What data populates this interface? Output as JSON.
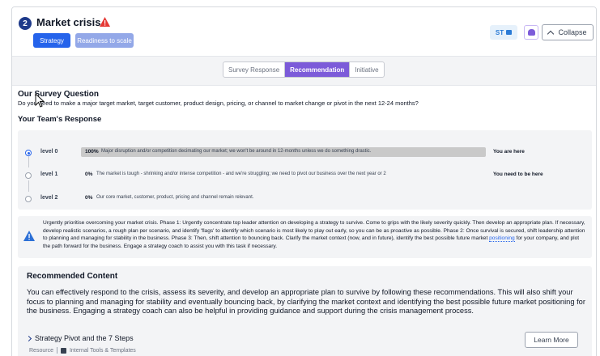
{
  "header": {
    "step_number": "2",
    "title": "Market crisis",
    "tags": [
      "Strategy",
      "Readiness to scale"
    ],
    "user_initials": "ST",
    "collapse_label": "Collapse"
  },
  "tabs": [
    {
      "label": "Survey Response",
      "active": false
    },
    {
      "label": "Recommendation",
      "active": true
    },
    {
      "label": "Initiative",
      "active": false
    }
  ],
  "survey": {
    "question_title": "Our Survey Question",
    "question_text": "Do you need to make a major target market, target customer, product design, pricing, or channel to market change or pivot in the next 12-24 months?",
    "response_title": "Your Team's Response",
    "levels": [
      {
        "name": "level 0",
        "percent": "100%",
        "description": "Major disruption and/or competition decimating our market; we won't be around in 12-months unless we do something drastic.",
        "note": "You are here",
        "selected": true
      },
      {
        "name": "level 1",
        "percent": "0%",
        "description": "The market is tough - shrinking and/or intense competition - and we're struggling; we need to pivot our business over the next year or 2",
        "note": "You need to be here",
        "selected": false
      },
      {
        "name": "level 2",
        "percent": "0%",
        "description": "Our core market, customer, product, pricing and channel remain relevant.",
        "note": "",
        "selected": false
      }
    ]
  },
  "advice": {
    "text_before": "Urgently prioritise overcoming your market crisis. Phase 1: Urgently concentrate top leader attention on developing a strategy to survive. Come to grips with the likely severity quickly. Then develop an appropriate plan. If necessary, develop realistic scenarios, a rough plan per scenario, and identify 'flags' to identify which scenario is most likely to play out early, so you can be as proactive as possible. Phase 2: Once survival is secured, shift leadership attention to planning and managing for stability in the business. Phase 3: Then, shift attention to bouncing back. Clarify the market context (now, and in future), identify the best possible future market ",
    "link_text": "positioning",
    "text_after": " for your company, and plot the path forward for the business. Engage a strategy coach to assist you with this task if necessary."
  },
  "recommended": {
    "title": "Recommended Content",
    "text": "You can effectively respond to the crisis, assess its severity, and develop an appropriate plan to survive by following these recommendations. This will also shift your focus to planning and managing for stability and eventually bouncing back, by clarifying the market context and identifying the best possible future market positioning for the business. Engaging a strategy coach can also be helpful in providing guidance and support during the crisis management process.",
    "item_title": "Strategy Pivot and the 7 Steps",
    "item_type": "Resource",
    "item_category": "Internal Tools & Templates",
    "learn_more_label": "Learn More"
  },
  "colors": {
    "primary": "#2563eb",
    "accent_purple": "#7c5bd9",
    "warning_red": "#e53935",
    "navy": "#1e3a8a"
  }
}
